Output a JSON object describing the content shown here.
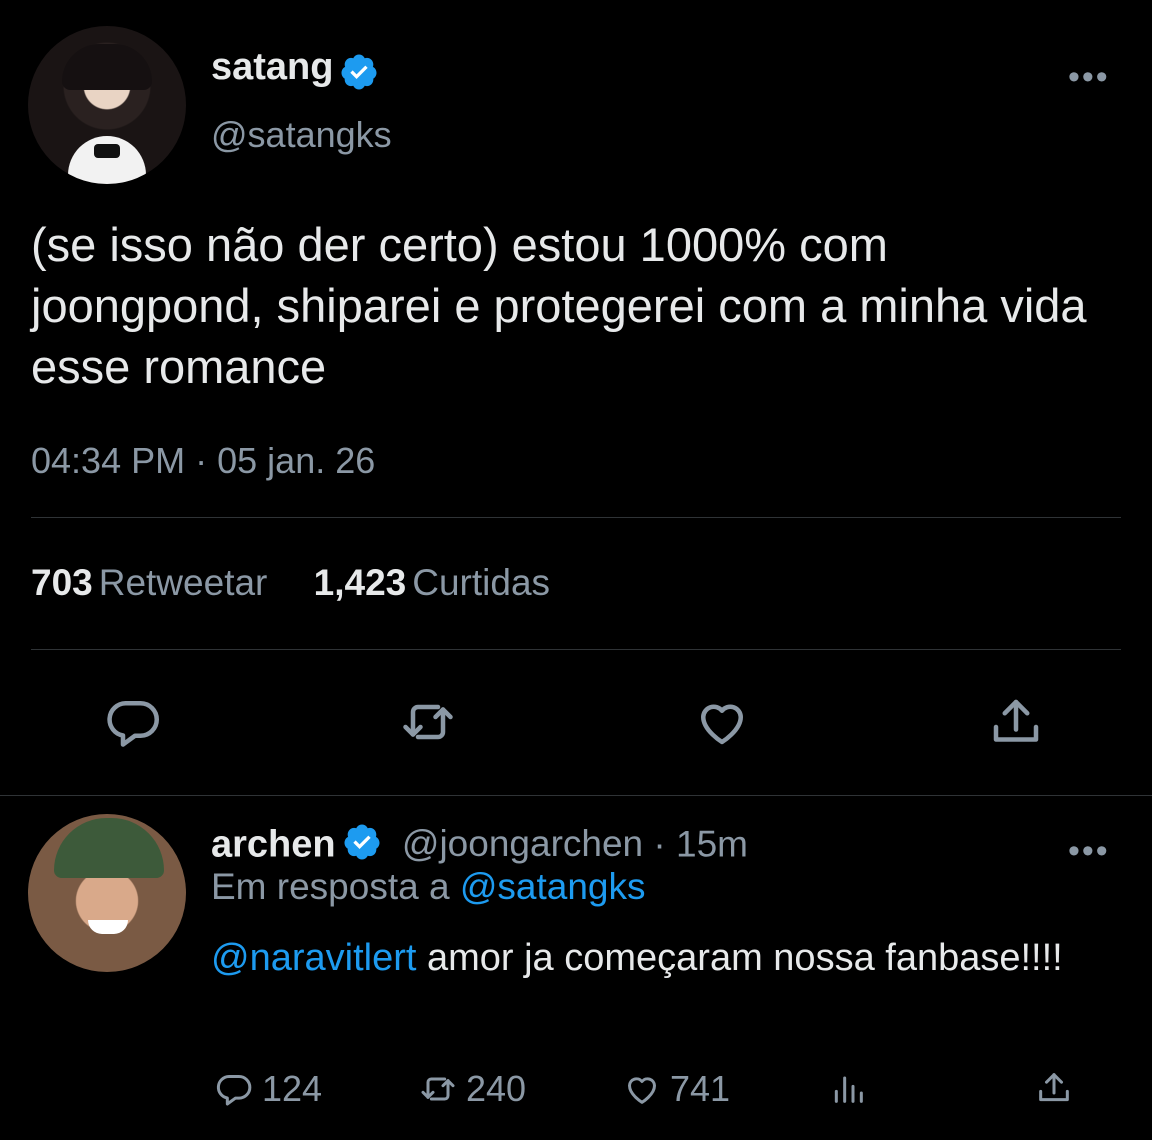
{
  "tweet": {
    "display_name": "satang",
    "handle": "@satangks",
    "text": "(se isso não der certo) estou 1000% com joongpond, shiparei e protegerei com a minha vida esse romance",
    "time": "04:34 PM",
    "date": "05 jan. 26",
    "separator": "·",
    "retweets_count": "703",
    "retweets_label": "Retweetar",
    "likes_count": "1,423",
    "likes_label": "Curtidas",
    "more": "•••"
  },
  "reply": {
    "display_name": "archen",
    "handle": "@joongarchen",
    "separator": "·",
    "time_ago": "15m",
    "reply_to_label": "Em resposta a",
    "reply_to_handle": "@satangks",
    "mention": "@naravitlert",
    "text": " amor ja começaram nossa fanbase!!!!",
    "replies": "124",
    "retweets": "240",
    "likes": "741",
    "more": "•••"
  },
  "colors": {
    "background": "#000000",
    "text": "#e7e9ea",
    "muted": "#8b98a5",
    "accent": "#1d9bf0",
    "divider": "#2f3336"
  },
  "icons": [
    "verified-badge-icon",
    "reply-icon",
    "retweet-icon",
    "like-icon",
    "share-icon",
    "analytics-icon",
    "more-icon"
  ]
}
